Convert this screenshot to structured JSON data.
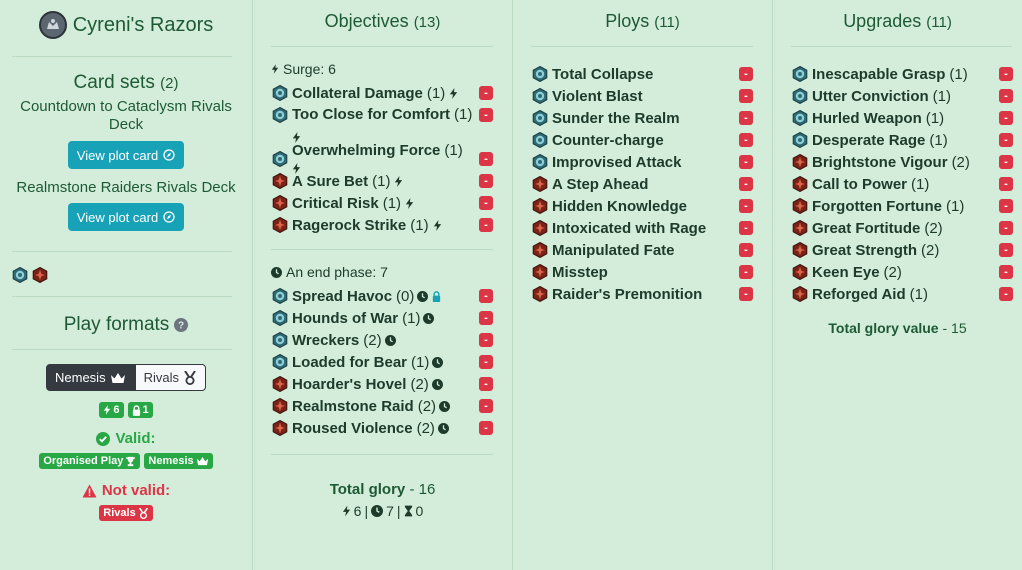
{
  "deck": {
    "name": "Cyreni's Razors"
  },
  "card_sets": {
    "title": "Card sets",
    "count": "(2)",
    "sets": [
      {
        "name": "Countdown to Cataclysm Rivals Deck",
        "button": "View plot card"
      },
      {
        "name": "Realmstone Raiders Rivals Deck",
        "button": "View plot card"
      }
    ]
  },
  "play_formats": {
    "title": "Play formats",
    "nemesis": "Nemesis",
    "rivals": "Rivals",
    "surge_count": "6",
    "lock_count": "1",
    "valid_label": "Valid:",
    "valid_badges": [
      "Organised Play",
      "Nemesis"
    ],
    "not_valid_label": "Not valid:",
    "not_valid_badges": [
      "Rivals"
    ]
  },
  "objectives": {
    "title": "Objectives",
    "count": "(13)",
    "surge_header": "Surge: 6",
    "end_header": "An end phase: 7",
    "surge_cards": [
      {
        "name": "Collateral Damage",
        "glory": "(1)",
        "faction": "blue"
      },
      {
        "name": "Too Close for Comfort",
        "glory": "(1)",
        "faction": "blue"
      },
      {
        "name": "Overwhelming Force",
        "glory": "(1)",
        "faction": "blue"
      },
      {
        "name": "A Sure Bet",
        "glory": "(1)",
        "faction": "red"
      },
      {
        "name": "Critical Risk",
        "glory": "(1)",
        "faction": "red"
      },
      {
        "name": "Ragerock Strike",
        "glory": "(1)",
        "faction": "red"
      }
    ],
    "end_cards": [
      {
        "name": "Spread Havoc",
        "glory": "(0)",
        "faction": "blue"
      },
      {
        "name": "Hounds of War",
        "glory": "(1)",
        "faction": "blue"
      },
      {
        "name": "Wreckers",
        "glory": "(2)",
        "faction": "blue"
      },
      {
        "name": "Loaded for Bear",
        "glory": "(1)",
        "faction": "blue"
      },
      {
        "name": "Hoarder's Hovel",
        "glory": "(2)",
        "faction": "red"
      },
      {
        "name": "Realmstone Raid",
        "glory": "(2)",
        "faction": "red"
      },
      {
        "name": "Roused Violence",
        "glory": "(2)",
        "faction": "red"
      }
    ],
    "total_label": "Total glory",
    "total_value": "- 16",
    "surge_total": "6",
    "end_total": "7",
    "third_total": "0"
  },
  "ploys": {
    "title": "Ploys",
    "count": "(11)",
    "cards": [
      {
        "name": "Total Collapse",
        "faction": "blue"
      },
      {
        "name": "Violent Blast",
        "faction": "blue"
      },
      {
        "name": "Sunder the Realm",
        "faction": "blue"
      },
      {
        "name": "Counter-charge",
        "faction": "blue"
      },
      {
        "name": "Improvised Attack",
        "faction": "blue"
      },
      {
        "name": "A Step Ahead",
        "faction": "red"
      },
      {
        "name": "Hidden Knowledge",
        "faction": "red"
      },
      {
        "name": "Intoxicated with Rage",
        "faction": "red"
      },
      {
        "name": "Manipulated Fate",
        "faction": "red"
      },
      {
        "name": "Misstep",
        "faction": "red"
      },
      {
        "name": "Raider's Premonition",
        "faction": "red"
      }
    ]
  },
  "upgrades": {
    "title": "Upgrades",
    "count": "(11)",
    "cards": [
      {
        "name": "Inescapable Grasp",
        "glory": "(1)",
        "faction": "blue"
      },
      {
        "name": "Utter Conviction",
        "glory": "(1)",
        "faction": "blue"
      },
      {
        "name": "Hurled Weapon",
        "glory": "(1)",
        "faction": "blue"
      },
      {
        "name": "Desperate Rage",
        "glory": "(1)",
        "faction": "blue"
      },
      {
        "name": "Brightstone Vigour",
        "glory": "(2)",
        "faction": "red"
      },
      {
        "name": "Call to Power",
        "glory": "(1)",
        "faction": "red"
      },
      {
        "name": "Forgotten Fortune",
        "glory": "(1)",
        "faction": "red"
      },
      {
        "name": "Great Fortitude",
        "glory": "(2)",
        "faction": "red"
      },
      {
        "name": "Great Strength",
        "glory": "(2)",
        "faction": "red"
      },
      {
        "name": "Keen Eye",
        "glory": "(2)",
        "faction": "red"
      },
      {
        "name": "Reforged Aid",
        "glory": "(1)",
        "faction": "red"
      }
    ],
    "total_label": "Total glory value",
    "total_value": "- 15"
  },
  "remove_label": "-",
  "colors": {
    "background": "#d4eddb",
    "heading": "#1d5a34",
    "button": "#17a2b8",
    "remove": "#dc3545",
    "valid": "#28a745"
  }
}
